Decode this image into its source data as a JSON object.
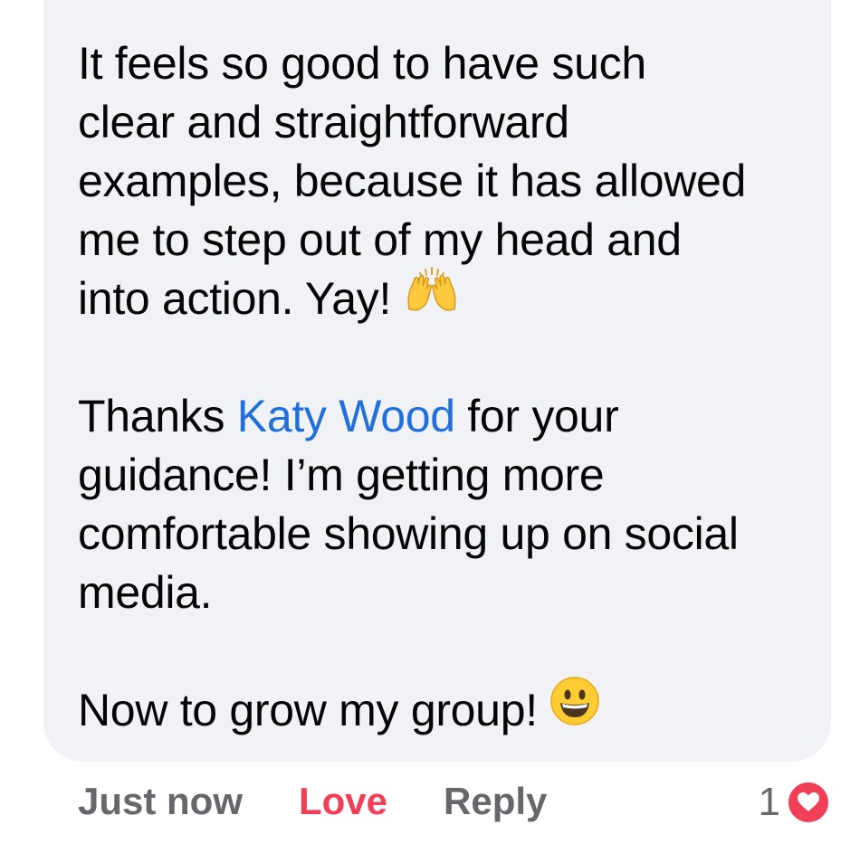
{
  "comment": {
    "lines_p1": [
      "It feels so good to have such",
      "clear and straightforward",
      "examples, because it has allowed",
      "me to step out of my head and",
      "into action. Yay!"
    ],
    "p2_prefix": "Thanks ",
    "mention": "Katy Wood",
    "p2_suffix": " for your",
    "lines_p2": [
      "guidance! I’m getting more",
      "comfortable showing up on social",
      "media."
    ],
    "line_p3": "Now to grow my group!",
    "emojis": {
      "raised_hands": "raising-hands-icon",
      "grinning": "grinning-face-icon"
    }
  },
  "actions": {
    "timestamp": "Just now",
    "love_label": "Love",
    "reply_label": "Reply",
    "reaction_count": "1",
    "reaction_icon": "heart-icon"
  },
  "colors": {
    "bubble_bg": "#f0f2f5",
    "mention": "#216fdb",
    "love": "#f33e58",
    "muted": "#65676b"
  }
}
